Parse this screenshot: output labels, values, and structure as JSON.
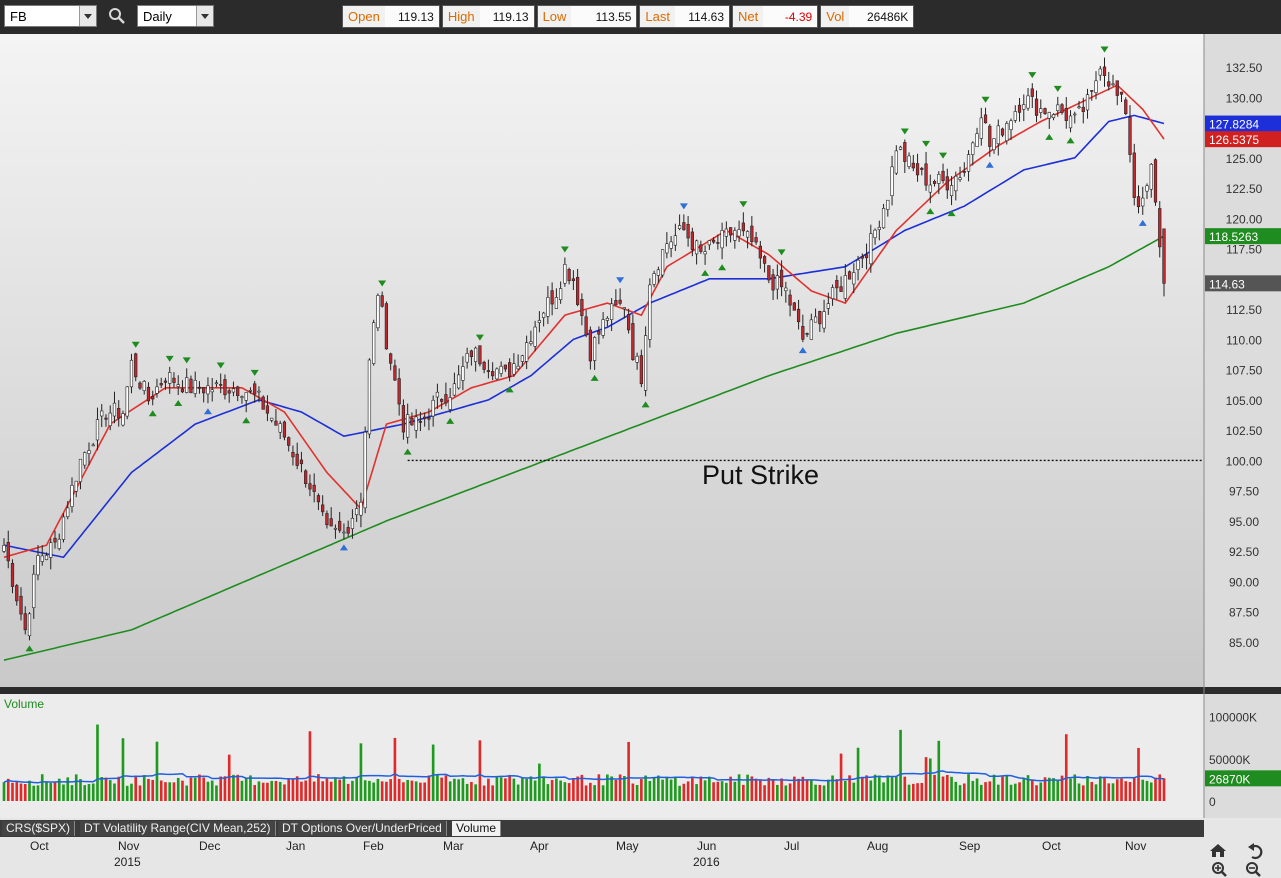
{
  "toolbar": {
    "symbol": "FB",
    "period": "Daily"
  },
  "quote": {
    "open_label": "Open",
    "open": "119.13",
    "high_label": "High",
    "high": "119.13",
    "low_label": "Low",
    "low": "113.55",
    "last_label": "Last",
    "last": "114.63",
    "net_label": "Net",
    "net": "-4.39",
    "vol_label": "Vol",
    "vol": "26486K"
  },
  "annotation": "Put Strike",
  "tabs": [
    "CRS($SPX)",
    "DT Volatility Range(CIV Mean,252)",
    "DT Options Over/UnderPriced",
    "Volume"
  ],
  "active_tab": "Volume",
  "colors": {
    "up": "#ffffff",
    "down": "#c0282d",
    "sma_short": "#e0322f",
    "sma_mid": "#1c2fd8",
    "sma_long": "#1f8c1f",
    "vol_up": "#1e9a1e",
    "vol_down": "#e02a2a",
    "vol_avg": "#2060e0"
  },
  "chart_data": {
    "type": "candlestick",
    "y_axis": {
      "range": [
        83,
        134
      ],
      "ticks": [
        "132.50",
        "130.00",
        "127.50",
        "125.00",
        "122.50",
        "120.00",
        "117.50",
        "115.00",
        "112.50",
        "110.00",
        "107.50",
        "105.00",
        "102.50",
        "100.00",
        "97.50",
        "95.00",
        "92.50",
        "90.00",
        "87.50",
        "85.00"
      ]
    },
    "price_labels": [
      {
        "value": "127.8284",
        "color": "#1c2fd8"
      },
      {
        "value": "126.5375",
        "color": "#d02020"
      },
      {
        "value": "118.5263",
        "color": "#1f8c1f"
      },
      {
        "value": "114.63",
        "color": "#555555"
      }
    ],
    "x_labels": [
      {
        "label": "Oct",
        "year": ""
      },
      {
        "label": "Nov",
        "year": "2015"
      },
      {
        "label": "Dec",
        "year": ""
      },
      {
        "label": "Jan",
        "year": ""
      },
      {
        "label": "Feb",
        "year": ""
      },
      {
        "label": "Mar",
        "year": ""
      },
      {
        "label": "Apr",
        "year": ""
      },
      {
        "label": "May",
        "year": ""
      },
      {
        "label": "Jun",
        "year": "2016"
      },
      {
        "label": "Jul",
        "year": ""
      },
      {
        "label": "Aug",
        "year": ""
      },
      {
        "label": "Sep",
        "year": ""
      },
      {
        "label": "Oct",
        "year": ""
      },
      {
        "label": "Nov",
        "year": ""
      }
    ],
    "close_anchors": [
      [
        0,
        93
      ],
      [
        5,
        86
      ],
      [
        8,
        92
      ],
      [
        12,
        93
      ],
      [
        18,
        100
      ],
      [
        24,
        104
      ],
      [
        28,
        104
      ],
      [
        30,
        108
      ],
      [
        34,
        105
      ],
      [
        38,
        107
      ],
      [
        44,
        106
      ],
      [
        50,
        106
      ],
      [
        56,
        106
      ],
      [
        60,
        105
      ],
      [
        66,
        102
      ],
      [
        72,
        98
      ],
      [
        76,
        94
      ],
      [
        80,
        94
      ],
      [
        84,
        97
      ],
      [
        86,
        108
      ],
      [
        88,
        114
      ],
      [
        90,
        110
      ],
      [
        94,
        103
      ],
      [
        98,
        103
      ],
      [
        102,
        105
      ],
      [
        106,
        106
      ],
      [
        110,
        109
      ],
      [
        114,
        108
      ],
      [
        118,
        107
      ],
      [
        122,
        109
      ],
      [
        126,
        112
      ],
      [
        130,
        114
      ],
      [
        132,
        116
      ],
      [
        134,
        115
      ],
      [
        136,
        112
      ],
      [
        138,
        109
      ],
      [
        142,
        112
      ],
      [
        146,
        113
      ],
      [
        148,
        109
      ],
      [
        150,
        107
      ],
      [
        152,
        115
      ],
      [
        156,
        118
      ],
      [
        160,
        119
      ],
      [
        164,
        117
      ],
      [
        168,
        118
      ],
      [
        172,
        119
      ],
      [
        176,
        118
      ],
      [
        180,
        115
      ],
      [
        184,
        114
      ],
      [
        188,
        110
      ],
      [
        192,
        112
      ],
      [
        196,
        114
      ],
      [
        200,
        116
      ],
      [
        204,
        118
      ],
      [
        208,
        122
      ],
      [
        210,
        126
      ],
      [
        214,
        124
      ],
      [
        218,
        123
      ],
      [
        222,
        123
      ],
      [
        226,
        124
      ],
      [
        230,
        129
      ],
      [
        232,
        126
      ],
      [
        236,
        128
      ],
      [
        240,
        130
      ],
      [
        244,
        129
      ],
      [
        248,
        129
      ],
      [
        252,
        128
      ],
      [
        256,
        130
      ],
      [
        258,
        133
      ],
      [
        262,
        130
      ],
      [
        264,
        129
      ],
      [
        266,
        122
      ],
      [
        268,
        121
      ],
      [
        270,
        124
      ],
      [
        272,
        118
      ],
      [
        273,
        114.63
      ]
    ],
    "sma_short_anchors": [
      [
        0,
        92
      ],
      [
        10,
        93
      ],
      [
        25,
        103
      ],
      [
        38,
        106
      ],
      [
        56,
        106
      ],
      [
        66,
        104
      ],
      [
        76,
        99
      ],
      [
        84,
        96
      ],
      [
        90,
        103
      ],
      [
        100,
        104
      ],
      [
        110,
        106
      ],
      [
        120,
        107
      ],
      [
        132,
        112
      ],
      [
        142,
        113
      ],
      [
        150,
        112
      ],
      [
        156,
        116
      ],
      [
        170,
        119
      ],
      [
        180,
        117
      ],
      [
        190,
        114
      ],
      [
        198,
        113
      ],
      [
        210,
        119
      ],
      [
        222,
        123
      ],
      [
        234,
        126
      ],
      [
        244,
        128
      ],
      [
        256,
        130
      ],
      [
        262,
        131
      ],
      [
        268,
        129
      ],
      [
        273,
        126.54
      ]
    ],
    "sma_mid_anchors": [
      [
        0,
        93
      ],
      [
        14,
        92
      ],
      [
        30,
        99
      ],
      [
        45,
        103
      ],
      [
        60,
        105
      ],
      [
        70,
        104
      ],
      [
        80,
        102
      ],
      [
        94,
        103
      ],
      [
        104,
        104
      ],
      [
        114,
        105
      ],
      [
        124,
        107
      ],
      [
        134,
        110
      ],
      [
        142,
        111
      ],
      [
        152,
        113
      ],
      [
        166,
        115
      ],
      [
        180,
        115
      ],
      [
        198,
        116
      ],
      [
        212,
        119
      ],
      [
        226,
        121
      ],
      [
        240,
        124
      ],
      [
        252,
        125
      ],
      [
        260,
        128
      ],
      [
        266,
        128.5
      ],
      [
        273,
        127.83
      ]
    ],
    "sma_long_anchors": [
      [
        0,
        83.5
      ],
      [
        30,
        86
      ],
      [
        60,
        90.5
      ],
      [
        90,
        95
      ],
      [
        120,
        99
      ],
      [
        150,
        103
      ],
      [
        180,
        107
      ],
      [
        210,
        110.5
      ],
      [
        240,
        113
      ],
      [
        260,
        116
      ],
      [
        273,
        118.53
      ]
    ],
    "putstrike": {
      "value": 100,
      "start_index": 95
    },
    "volume": {
      "y_ticks": [
        "100000K",
        "50000K",
        "0"
      ],
      "last_label": "26870K",
      "title": "Volume"
    }
  }
}
